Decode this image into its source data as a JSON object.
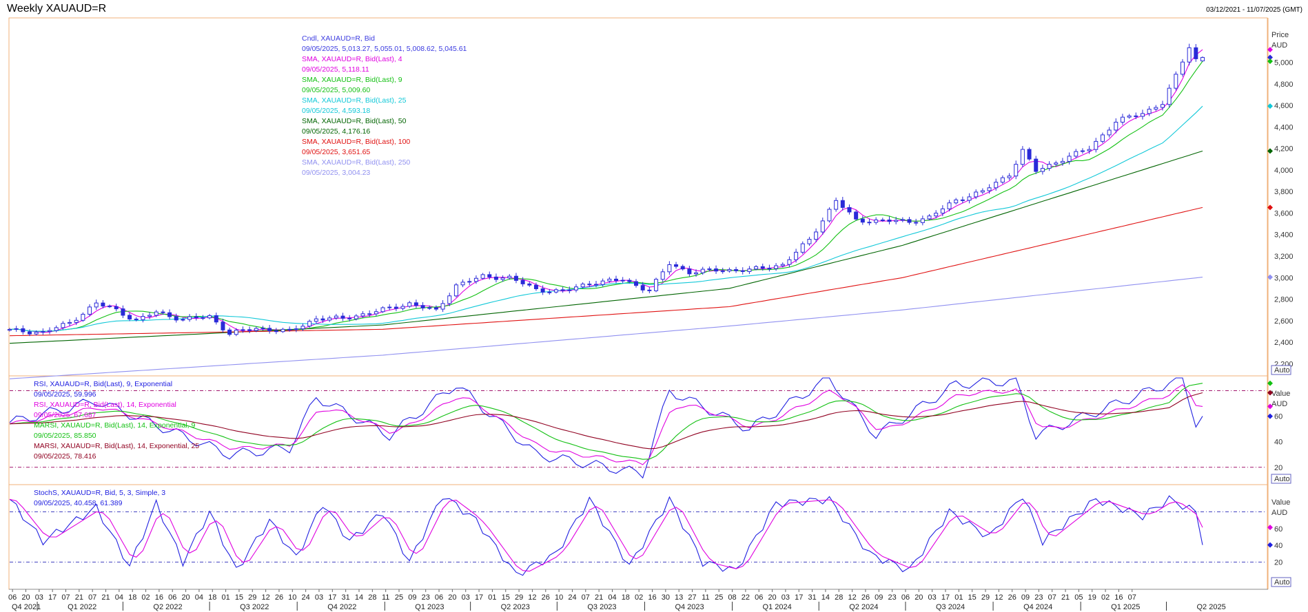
{
  "window": {
    "title": "Weekly XAUAUD=R",
    "date_range": "03/12/2021 - 11/07/2025 (GMT)"
  },
  "price_panel": {
    "axis_title": "Price",
    "axis_unit": "AUD",
    "auto_label": "Auto",
    "ticks": [
      "2,200",
      "2,400",
      "2,600",
      "2,800",
      "3,000",
      "3,200",
      "3,400",
      "3,600",
      "3,800",
      "4,000",
      "4,200",
      "4,400",
      "4,600",
      "4,800",
      "5,000"
    ],
    "legend": [
      {
        "line1": "Cndl, XAUAUD=R, Bid",
        "line2": "09/05/2025, 5,013.27, 5,055.01, 5,008.62, 5,045.61",
        "color": "#3a3ae0"
      },
      {
        "line1": "SMA, XAUAUD=R, Bid(Last),  4",
        "line2": "09/05/2025, 5,118.11",
        "color": "#e000e0"
      },
      {
        "line1": "SMA, XAUAUD=R, Bid(Last),  9",
        "line2": "09/05/2025, 5,009.60",
        "color": "#12c012"
      },
      {
        "line1": "SMA, XAUAUD=R, Bid(Last),  25",
        "line2": "09/05/2025, 4,593.18",
        "color": "#10c8d8"
      },
      {
        "line1": "SMA, XAUAUD=R, Bid(Last),  50",
        "line2": "09/05/2025, 4,176.16",
        "color": "#006400"
      },
      {
        "line1": "SMA, XAUAUD=R, Bid(Last),  100",
        "line2": "09/05/2025, 3,651.65",
        "color": "#e01010"
      },
      {
        "line1": "SMA, XAUAUD=R, Bid(Last),  250",
        "line2": "09/05/2025, 3,004.23",
        "color": "#9090f0"
      }
    ]
  },
  "rsi_panel": {
    "axis_title": "Value",
    "axis_unit": "AUD",
    "auto_label": "Auto",
    "ticks": [
      "20",
      "40",
      "60"
    ],
    "legend": [
      {
        "line1": "RSI, XAUAUD=R, Bid(Last),  9, Exponential",
        "line2": "09/05/2025, 59.996",
        "color": "#2020e0"
      },
      {
        "line1": "RSI, XAUAUD=R, Bid(Last),  14, Exponential",
        "line2": "09/05/2025, 67.687",
        "color": "#e000e0"
      },
      {
        "line1": "MARSI, XAUAUD=R, Bid(Last),  14, Exponential, 9",
        "line2": "09/05/2025, 85.850",
        "color": "#12c012"
      },
      {
        "line1": "MARSI, XAUAUD=R, Bid(Last),  14, Exponential, 25",
        "line2": "09/05/2025, 78.416",
        "color": "#900020"
      }
    ]
  },
  "stoch_panel": {
    "axis_title": "Value",
    "axis_unit": "AUD",
    "auto_label": "Auto",
    "ticks": [
      "20",
      "40",
      "60"
    ],
    "legend": [
      {
        "line1": "StochS, XAUAUD=R, Bid,  5, 3, Simple, 3",
        "line2": "09/05/2025, 40.458, 61.389",
        "color": "#2020e0"
      }
    ]
  },
  "x_axis": {
    "week_labels": [
      "06",
      "20",
      "03",
      "17",
      "07",
      "21",
      "07",
      "21",
      "04",
      "18",
      "02",
      "16",
      "06",
      "20",
      "04",
      "18",
      "01",
      "15",
      "29",
      "12",
      "26",
      "10",
      "24",
      "03",
      "17",
      "31",
      "14",
      "28",
      "11",
      "25",
      "09",
      "23",
      "06",
      "20",
      "03",
      "17",
      "01",
      "15",
      "29",
      "12",
      "26",
      "10",
      "24",
      "07",
      "21",
      "04",
      "18",
      "02",
      "16",
      "30",
      "13",
      "27",
      "11",
      "25",
      "08",
      "22",
      "06",
      "20",
      "03",
      "17",
      "31",
      "14",
      "28",
      "12",
      "26",
      "09",
      "23",
      "06",
      "20",
      "03",
      "17",
      "01",
      "15",
      "29",
      "12",
      "26",
      "09",
      "23",
      "07",
      "21",
      "05",
      "19",
      "02",
      "16",
      "07"
    ],
    "quarter_labels": [
      "Q4 2021",
      "Q1 2022",
      "Q2 2022",
      "Q3 2022",
      "Q4 2022",
      "Q1 2023",
      "Q2 2023",
      "Q3 2023",
      "Q4 2023",
      "Q1 2024",
      "Q2 2024",
      "Q3 2024",
      "Q4 2024",
      "Q1 2025",
      "Q2 2025"
    ]
  },
  "chart_data": [
    {
      "type": "candlestick",
      "title": "Weekly XAUAUD=R",
      "ylabel": "Price AUD",
      "ylim": [
        2100,
        5400
      ],
      "x_start": "2021-12-03",
      "x_end": "2025-05-09",
      "last_candle": {
        "date": "09/05/2025",
        "open": 5013.27,
        "high": 5055.01,
        "low": 5008.62,
        "close": 5045.61
      },
      "close_anchors": [
        [
          "2021-12-03",
          2510
        ],
        [
          "2022-01-07",
          2490
        ],
        [
          "2022-02-04",
          2580
        ],
        [
          "2022-03-04",
          2760
        ],
        [
          "2022-03-25",
          2700
        ],
        [
          "2022-04-15",
          2600
        ],
        [
          "2022-05-06",
          2680
        ],
        [
          "2022-06-03",
          2610
        ],
        [
          "2022-07-01",
          2640
        ],
        [
          "2022-07-22",
          2480
        ],
        [
          "2022-08-19",
          2530
        ],
        [
          "2022-09-23",
          2500
        ],
        [
          "2022-10-21",
          2620
        ],
        [
          "2022-11-18",
          2620
        ],
        [
          "2022-12-30",
          2700
        ],
        [
          "2023-01-27",
          2760
        ],
        [
          "2023-02-24",
          2690
        ],
        [
          "2023-03-17",
          2930
        ],
        [
          "2023-04-14",
          3010
        ],
        [
          "2023-05-12",
          3000
        ],
        [
          "2023-06-09",
          2890
        ],
        [
          "2023-07-07",
          2870
        ],
        [
          "2023-08-04",
          2950
        ],
        [
          "2023-09-08",
          2980
        ],
        [
          "2023-10-06",
          2880
        ],
        [
          "2023-10-27",
          3130
        ],
        [
          "2023-11-17",
          3050
        ],
        [
          "2023-12-15",
          3070
        ],
        [
          "2024-01-19",
          3070
        ],
        [
          "2024-02-23",
          3120
        ],
        [
          "2024-03-22",
          3350
        ],
        [
          "2024-04-19",
          3720
        ],
        [
          "2024-05-10",
          3530
        ],
        [
          "2024-06-07",
          3530
        ],
        [
          "2024-07-05",
          3520
        ],
        [
          "2024-07-26",
          3560
        ],
        [
          "2024-08-23",
          3720
        ],
        [
          "2024-09-20",
          3800
        ],
        [
          "2024-10-18",
          3960
        ],
        [
          "2024-11-01",
          4180
        ],
        [
          "2024-11-15",
          3990
        ],
        [
          "2024-12-13",
          4100
        ],
        [
          "2025-01-10",
          4200
        ],
        [
          "2025-02-07",
          4450
        ],
        [
          "2025-03-07",
          4530
        ],
        [
          "2025-03-28",
          4620
        ],
        [
          "2025-04-11",
          4870
        ],
        [
          "2025-04-25",
          5150
        ],
        [
          "2025-05-02",
          5030
        ],
        [
          "2025-05-09",
          5045
        ]
      ]
    },
    {
      "type": "line",
      "title": "SMA 4 / 9 / 25 / 50 / 100 / 250",
      "ylim": [
        2100,
        5400
      ],
      "series": [
        {
          "name": "SMA 4",
          "period": 4,
          "color": "#e000e0",
          "last": 5118.11
        },
        {
          "name": "SMA 9",
          "period": 9,
          "color": "#12c012",
          "last": 5009.6
        },
        {
          "name": "SMA 25",
          "period": 25,
          "color": "#10c8d8",
          "last": 4593.18
        },
        {
          "name": "SMA 50",
          "period": 50,
          "color": "#006400",
          "x": [
            "2021-12-03",
            "2022-12-30",
            "2023-12-29",
            "2024-06-28",
            "2025-05-09"
          ],
          "values": [
            2390,
            2560,
            2900,
            3300,
            4176.16
          ]
        },
        {
          "name": "SMA 100",
          "period": 100,
          "color": "#e01010",
          "x": [
            "2021-12-03",
            "2022-12-30",
            "2023-12-29",
            "2024-06-28",
            "2025-05-09"
          ],
          "values": [
            2460,
            2520,
            2730,
            3000,
            3651.65
          ]
        },
        {
          "name": "SMA 250",
          "period": 250,
          "color": "#9090f0",
          "x": [
            "2021-12-03",
            "2022-12-30",
            "2023-12-29",
            "2024-06-28",
            "2025-05-09"
          ],
          "values": [
            2060,
            2280,
            2550,
            2700,
            3004.23
          ]
        }
      ]
    },
    {
      "type": "line",
      "title": "RSI",
      "ylim": [
        8,
        90
      ],
      "reference_lines": [
        20,
        80
      ],
      "series": [
        {
          "name": "RSI 9",
          "color": "#2020e0",
          "x": [
            "2021-12-03",
            "2022-03-04",
            "2022-07-22",
            "2022-09-23",
            "2022-10-21",
            "2023-01-06",
            "2023-03-17",
            "2023-06-09",
            "2023-09-29",
            "2023-10-27",
            "2024-01-19",
            "2024-04-12",
            "2024-05-31",
            "2024-08-23",
            "2024-10-25",
            "2024-11-15",
            "2025-04-18",
            "2025-05-02",
            "2025-05-09"
          ],
          "values": [
            55,
            72,
            30,
            35,
            75,
            45,
            85,
            30,
            15,
            80,
            50,
            90,
            45,
            85,
            88,
            45,
            90,
            55,
            59.996
          ]
        },
        {
          "name": "RSI 14",
          "color": "#e000e0",
          "last": 67.687
        },
        {
          "name": "MARSI 14/9",
          "color": "#12c012",
          "last": 85.85
        },
        {
          "name": "MARSI 14/25",
          "color": "#900020",
          "last": 78.416
        }
      ]
    },
    {
      "type": "line",
      "title": "StochS",
      "ylim": [
        -10,
        110
      ],
      "reference_lines": [
        20,
        80
      ],
      "series": [
        {
          "name": "StochS %K",
          "color": "#2020e0",
          "x": [
            "2021-12-03",
            "2022-01-07",
            "2022-03-04",
            "2022-04-08",
            "2022-05-06",
            "2022-06-03",
            "2022-07-01",
            "2022-07-29",
            "2022-09-02",
            "2022-09-30",
            "2022-10-28",
            "2022-11-25",
            "2022-12-30",
            "2023-01-27",
            "2023-03-03",
            "2023-04-07",
            "2023-05-19",
            "2023-06-30",
            "2023-08-04",
            "2023-09-15",
            "2023-10-27",
            "2023-12-01",
            "2024-01-05",
            "2024-02-16",
            "2024-04-12",
            "2024-05-24",
            "2024-07-05",
            "2024-08-16",
            "2024-09-27",
            "2024-11-01",
            "2024-11-22",
            "2025-01-17",
            "2025-03-07",
            "2025-04-04",
            "2025-05-02",
            "2025-05-09"
          ],
          "values": [
            95,
            45,
            85,
            15,
            90,
            20,
            80,
            10,
            70,
            25,
            90,
            45,
            80,
            20,
            100,
            70,
            5,
            30,
            95,
            15,
            95,
            20,
            10,
            90,
            95,
            30,
            10,
            80,
            50,
            100,
            45,
            95,
            75,
            95,
            80,
            40.458
          ]
        },
        {
          "name": "StochS %D",
          "color": "#e000e0",
          "last": 61.389
        }
      ]
    }
  ]
}
